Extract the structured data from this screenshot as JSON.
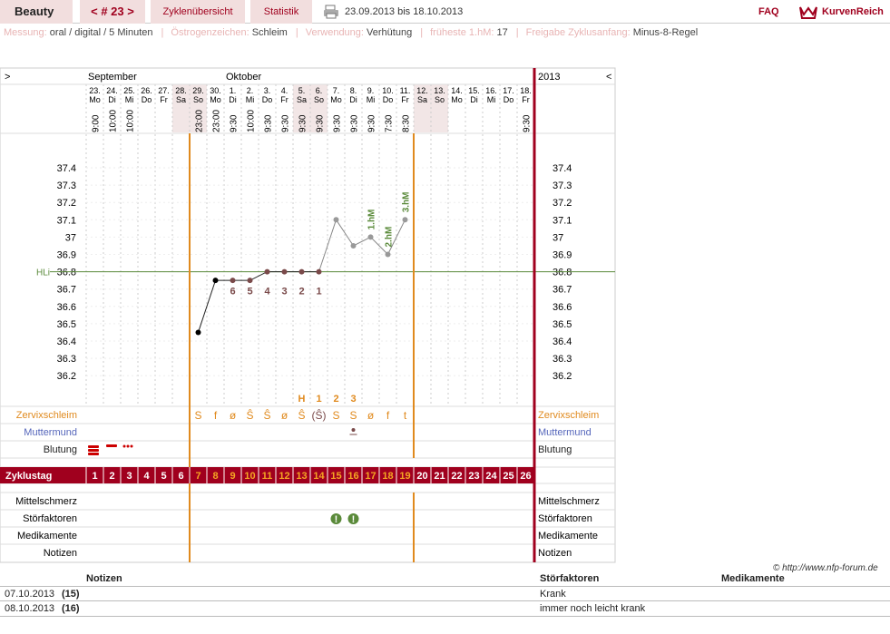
{
  "header": {
    "user_name": "Beauty",
    "cycle_nav": "< # 23 >",
    "tab_overview": "Zyklenübersicht",
    "tab_stats": "Statistik",
    "date_range": "23.09.2013 bis 18.10.2013",
    "faq": "FAQ",
    "logo_text": "KurvenReich"
  },
  "info": {
    "items": [
      {
        "label": "Messung:",
        "value": "oral / digital / 5 Minuten"
      },
      {
        "label": "Östrogenzeichen:",
        "value": "Schleim"
      },
      {
        "label": "Verwendung:",
        "value": "Verhütung"
      },
      {
        "label": "früheste 1.hM:",
        "value": "17"
      },
      {
        "label": "Freigabe Zyklusanfang:",
        "value": "Minus-8-Regel"
      }
    ]
  },
  "nav": {
    "prev": ">",
    "next": "<",
    "year": "2013"
  },
  "months": [
    {
      "name": "September",
      "col": 0
    },
    {
      "name": "Oktober",
      "col": 8
    }
  ],
  "days": [
    {
      "d": "23.",
      "w": "Mo",
      "t": "9:00"
    },
    {
      "d": "24.",
      "w": "Di",
      "t": "10:00"
    },
    {
      "d": "25.",
      "w": "Mi",
      "t": "10:00"
    },
    {
      "d": "26.",
      "w": "Do",
      "t": ""
    },
    {
      "d": "27.",
      "w": "Fr",
      "t": ""
    },
    {
      "d": "28.",
      "w": "Sa",
      "t": ""
    },
    {
      "d": "29.",
      "w": "So",
      "t": "23:00"
    },
    {
      "d": "30.",
      "w": "Mo",
      "t": "23:00"
    },
    {
      "d": "1.",
      "w": "Di",
      "t": "9:30"
    },
    {
      "d": "2.",
      "w": "Mi",
      "t": "10:00"
    },
    {
      "d": "3.",
      "w": "Do",
      "t": "9:30"
    },
    {
      "d": "4.",
      "w": "Fr",
      "t": "9:30"
    },
    {
      "d": "5.",
      "w": "Sa",
      "t": "9:30"
    },
    {
      "d": "6.",
      "w": "So",
      "t": "9:30"
    },
    {
      "d": "7.",
      "w": "Mo",
      "t": "9:30"
    },
    {
      "d": "8.",
      "w": "Di",
      "t": "9:30"
    },
    {
      "d": "9.",
      "w": "Mi",
      "t": "9:30"
    },
    {
      "d": "10.",
      "w": "Do",
      "t": "7:30"
    },
    {
      "d": "11.",
      "w": "Fr",
      "t": "8:30"
    },
    {
      "d": "12.",
      "w": "Sa",
      "t": ""
    },
    {
      "d": "13.",
      "w": "So",
      "t": ""
    },
    {
      "d": "14.",
      "w": "Mo",
      "t": ""
    },
    {
      "d": "15.",
      "w": "Di",
      "t": ""
    },
    {
      "d": "16.",
      "w": "Mi",
      "t": ""
    },
    {
      "d": "17.",
      "w": "Do",
      "t": ""
    },
    {
      "d": "18.",
      "w": "Fr",
      "t": "9:30"
    }
  ],
  "weekend_cols": [
    5,
    6,
    12,
    13,
    19,
    20
  ],
  "chart_data": {
    "type": "line",
    "yticks": [
      "37.4",
      "37.3",
      "37.2",
      "37.1",
      "37",
      "36.9",
      "36.8",
      "36.7",
      "36.6",
      "36.5",
      "36.4",
      "36.3",
      "36.2"
    ],
    "ylim": [
      36.2,
      37.4
    ],
    "cover_line": {
      "label": "HLi",
      "value": 36.8
    },
    "points": [
      {
        "col": 6,
        "v": 36.45
      },
      {
        "col": 7,
        "v": 36.75
      },
      {
        "col": 8,
        "v": 36.75
      },
      {
        "col": 9,
        "v": 36.75
      },
      {
        "col": 10,
        "v": 36.8
      },
      {
        "col": 11,
        "v": 36.8
      },
      {
        "col": 12,
        "v": 36.8
      },
      {
        "col": 13,
        "v": 36.8
      },
      {
        "col": 14,
        "v": 37.1
      },
      {
        "col": 15,
        "v": 36.95
      },
      {
        "col": 16,
        "v": 37.0
      },
      {
        "col": 17,
        "v": 36.9
      },
      {
        "col": 18,
        "v": 37.1
      }
    ],
    "low_labels": [
      {
        "col": 8,
        "t": "6"
      },
      {
        "col": 9,
        "t": "5"
      },
      {
        "col": 10,
        "t": "4"
      },
      {
        "col": 11,
        "t": "3"
      },
      {
        "col": 12,
        "t": "2"
      },
      {
        "col": 13,
        "t": "1"
      }
    ],
    "hm_labels": [
      {
        "col": 16,
        "t": "1.hM"
      },
      {
        "col": 17,
        "t": "2.hM"
      },
      {
        "col": 18,
        "t": "3.hM"
      }
    ],
    "peak_labels": [
      {
        "col": 12,
        "t": "H"
      },
      {
        "col": 13,
        "t": "1"
      },
      {
        "col": 14,
        "t": "2"
      },
      {
        "col": 15,
        "t": "3"
      }
    ],
    "mucus": [
      {
        "col": 6,
        "t": "S"
      },
      {
        "col": 7,
        "t": "f"
      },
      {
        "col": 8,
        "t": "ø"
      },
      {
        "col": 9,
        "t": "Ŝ"
      },
      {
        "col": 10,
        "t": "Ŝ"
      },
      {
        "col": 11,
        "t": "ø"
      },
      {
        "col": 12,
        "t": "Ŝ"
      },
      {
        "col": 13,
        "t": "(Ŝ)"
      },
      {
        "col": 14,
        "t": "S"
      },
      {
        "col": 15,
        "t": "S"
      },
      {
        "col": 16,
        "t": "ø"
      },
      {
        "col": 17,
        "t": "f"
      },
      {
        "col": 18,
        "t": "t"
      }
    ]
  },
  "rows": {
    "mucus": "Zervixschleim",
    "cervix": "Muttermund",
    "bleeding": "Blutung",
    "cycle_day": "Zyklustag",
    "mittelschmerz": "Mittelschmerz",
    "disturbance": "Störfaktoren",
    "medication": "Medikamente",
    "notes": "Notizen"
  },
  "cycle_days": [
    "1",
    "2",
    "3",
    "4",
    "5",
    "6",
    "7",
    "8",
    "9",
    "10",
    "11",
    "12",
    "13",
    "14",
    "15",
    "16",
    "17",
    "18",
    "19",
    "20",
    "21",
    "22",
    "23",
    "24",
    "25",
    "26"
  ],
  "copyright": "© http://www.nfp-forum.de",
  "notes_table": {
    "col_notes": "Notizen",
    "col_disturbance": "Störfaktoren",
    "col_medication": "Medikamente",
    "rows": [
      {
        "date": "07.10.2013",
        "day": "(15)",
        "disturbance": "Krank"
      },
      {
        "date": "08.10.2013",
        "day": "(16)",
        "disturbance": "immer noch leicht krank"
      }
    ]
  },
  "colors": {
    "accent": "#a0001e",
    "orange": "#e08a1e",
    "green": "#5a8a3a",
    "blue": "#5566bb"
  }
}
